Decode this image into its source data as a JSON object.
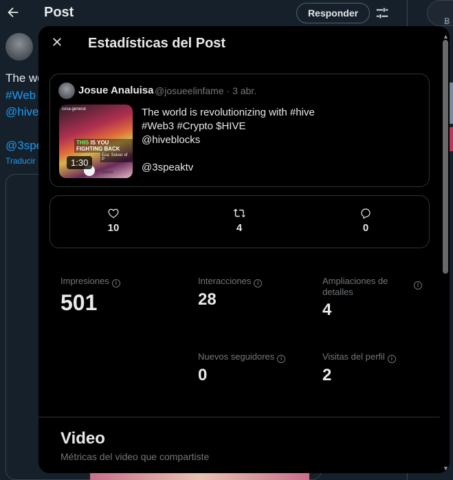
{
  "background": {
    "header_title": "Post",
    "reply_button": "Responder",
    "search_placeholder": "B",
    "text_line1": "The wo",
    "text_line2": "#Web",
    "text_line3": "@hive",
    "text_line4": "@3spe",
    "translate": "Traducir"
  },
  "modal": {
    "title": "Estadísticas del Post",
    "quote": {
      "author_name": "Josue Analuisa",
      "author_handle": "@josueelinfame",
      "separator": "·",
      "date": "3 abr.",
      "duration": "1:30",
      "text": "The world is revolutionizing with #hive\n#Web3  #Crypto $HIVE\n@hiveblocks\n\n@3speaktv",
      "thumb_top": "cosa-general",
      "thumb_headline_green": "THIS",
      "thumb_headline_rest": "IS YOU FIGHTING BACK",
      "thumb_eca": "Eca: Solver of P",
      "thumb_memo": "memo"
    },
    "engagement": {
      "likes": "10",
      "reposts": "4",
      "replies": "0"
    },
    "metrics": {
      "impressions_label": "Impresiones",
      "impressions_value": "501",
      "interactions_label": "Interacciones",
      "interactions_value": "28",
      "detail_expands_label": "Ampliaciones de detalles",
      "detail_expands_value": "4",
      "new_followers_label": "Nuevos seguidores",
      "new_followers_value": "0",
      "profile_visits_label": "Visitas del perfil",
      "profile_visits_value": "2"
    },
    "video": {
      "title": "Video",
      "subtitle": "Métricas del video que compartiste"
    }
  },
  "colors": {
    "background": "#15202b",
    "modal": "#000000",
    "link": "#1d9bf0",
    "muted": "#71767b"
  }
}
